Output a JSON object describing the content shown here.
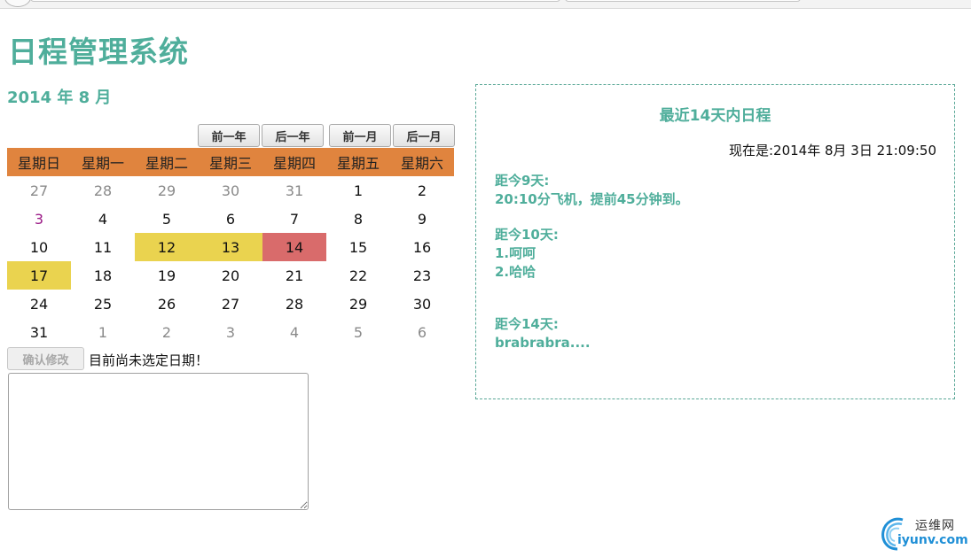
{
  "app": {
    "title": "日程管理系统"
  },
  "calendar": {
    "month_label": "2014 年 8 月",
    "nav": {
      "prev_year": "前一年",
      "next_year": "后一年",
      "prev_month": "前一月",
      "next_month": "后一月"
    },
    "weekdays": [
      "星期日",
      "星期一",
      "星期二",
      "星期三",
      "星期四",
      "星期五",
      "星期六"
    ],
    "weeks": [
      [
        {
          "d": "27",
          "t": "other"
        },
        {
          "d": "28",
          "t": "other"
        },
        {
          "d": "29",
          "t": "other"
        },
        {
          "d": "30",
          "t": "other"
        },
        {
          "d": "31",
          "t": "other"
        },
        {
          "d": "1",
          "t": ""
        },
        {
          "d": "2",
          "t": ""
        }
      ],
      [
        {
          "d": "3",
          "t": "today"
        },
        {
          "d": "4",
          "t": ""
        },
        {
          "d": "5",
          "t": ""
        },
        {
          "d": "6",
          "t": ""
        },
        {
          "d": "7",
          "t": ""
        },
        {
          "d": "8",
          "t": ""
        },
        {
          "d": "9",
          "t": ""
        }
      ],
      [
        {
          "d": "10",
          "t": ""
        },
        {
          "d": "11",
          "t": ""
        },
        {
          "d": "12",
          "t": "has-event"
        },
        {
          "d": "13",
          "t": "has-event"
        },
        {
          "d": "14",
          "t": "hl-red"
        },
        {
          "d": "15",
          "t": ""
        },
        {
          "d": "16",
          "t": ""
        }
      ],
      [
        {
          "d": "17",
          "t": "has-event"
        },
        {
          "d": "18",
          "t": ""
        },
        {
          "d": "19",
          "t": ""
        },
        {
          "d": "20",
          "t": ""
        },
        {
          "d": "21",
          "t": ""
        },
        {
          "d": "22",
          "t": ""
        },
        {
          "d": "23",
          "t": ""
        }
      ],
      [
        {
          "d": "24",
          "t": ""
        },
        {
          "d": "25",
          "t": ""
        },
        {
          "d": "26",
          "t": ""
        },
        {
          "d": "27",
          "t": ""
        },
        {
          "d": "28",
          "t": ""
        },
        {
          "d": "29",
          "t": ""
        },
        {
          "d": "30",
          "t": ""
        }
      ],
      [
        {
          "d": "31",
          "t": ""
        },
        {
          "d": "1",
          "t": "other"
        },
        {
          "d": "2",
          "t": "other"
        },
        {
          "d": "3",
          "t": "other"
        },
        {
          "d": "4",
          "t": "other"
        },
        {
          "d": "5",
          "t": "other"
        },
        {
          "d": "6",
          "t": "other"
        }
      ]
    ]
  },
  "editor": {
    "confirm_label": "确认修改",
    "status": "目前尚未选定日期！",
    "note_value": ""
  },
  "schedule": {
    "title": "最近14天内日程",
    "now_text": "现在是:2014年 8月 3日 21:09:50",
    "groups": [
      {
        "heading": "距今9天:",
        "items": [
          "20:10分飞机，提前45分钟到。"
        ]
      },
      {
        "heading": "距今10天:",
        "items": [
          "1.呵呵",
          "2.哈哈"
        ]
      },
      {
        "heading": "距今14天:",
        "items": [
          "brabrabra...."
        ]
      }
    ]
  },
  "watermark": {
    "cn": "运维网",
    "en": "iyunv.com"
  },
  "colors": {
    "accent": "#4fae9b",
    "header_bg": "#e0843e",
    "event_yellow": "#ead34f",
    "event_red": "#d96b6b",
    "today_text": "#9b1a86"
  }
}
